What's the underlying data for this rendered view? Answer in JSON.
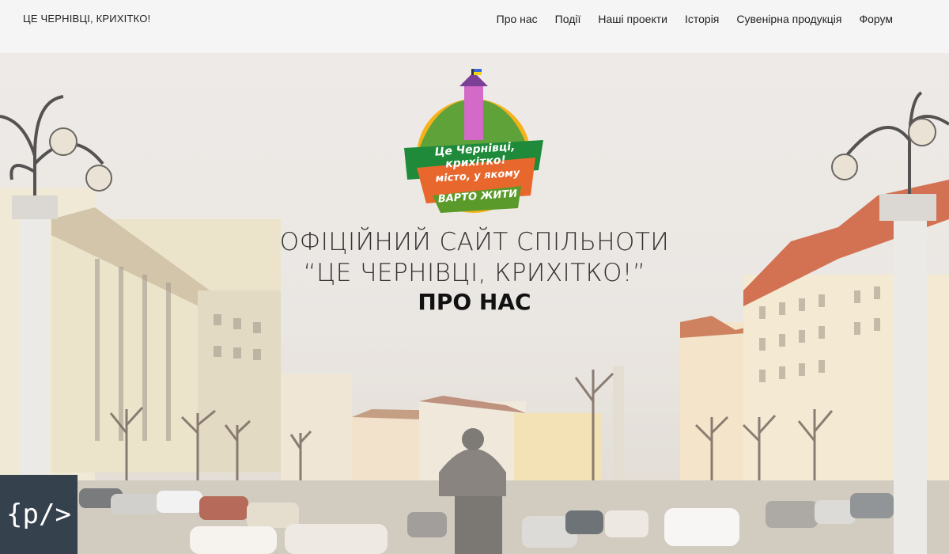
{
  "header": {
    "brand": "ЦЕ ЧЕРНІВЦІ, КРИХІТКО!",
    "nav": [
      "Про нас",
      "Події",
      "Наші проекти",
      "Історія",
      "Сувенірна продукція",
      "Форум"
    ]
  },
  "hero": {
    "logo_line1": "Це Чернівці, крихітко!",
    "logo_line2": "місто, у якому",
    "logo_line3": "ВАРТО ЖИТИ",
    "title_line1": "ОФІЦІЙНИЙ САЙТ СПІЛЬНОТИ",
    "title_line2": "“ЦЕ ЧЕРНІВЦІ, КРИХІТКО!”",
    "title_line3": "ПРО НАС"
  },
  "badge": {
    "text": "{p/>",
    "icon": "code-icon"
  },
  "colors": {
    "logo_green": "#5a9a2a",
    "logo_orange": "#e0782a",
    "logo_red": "#c62e24",
    "badge_bg": "#35414d"
  }
}
